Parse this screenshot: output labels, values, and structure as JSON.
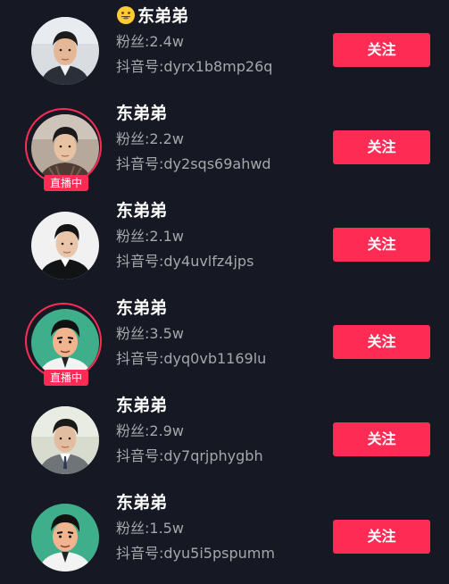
{
  "follow_label": "关注",
  "live_label": "直播中",
  "accent_color": "#fe2c55",
  "background_color": "#161823",
  "users": [
    {
      "name": "东弟弟",
      "name_emoji": "grinning-face-emoji",
      "fans": "粉丝:2.4w",
      "douyin_id": "抖音号:dyrx1b8mp26q",
      "is_live": false,
      "avatar": "man-dark-suit-avatar"
    },
    {
      "name": "东弟弟",
      "fans": "粉丝:2.2w",
      "douyin_id": "抖音号:dy2sqs69ahwd",
      "is_live": true,
      "avatar": "man-checked-shirt-avatar"
    },
    {
      "name": "东弟弟",
      "fans": "粉丝:2.1w",
      "douyin_id": "抖音号:dy4uvlfz4jps",
      "is_live": false,
      "avatar": "man-black-coat-avatar"
    },
    {
      "name": "东弟弟",
      "fans": "粉丝:3.5w",
      "douyin_id": "抖音号:dyq0vb1169lu",
      "is_live": true,
      "avatar": "cartoon-man-green-avatar"
    },
    {
      "name": "东弟弟",
      "fans": "粉丝:2.9w",
      "douyin_id": "抖音号:dy7qrjphygbh",
      "is_live": false,
      "avatar": "man-grey-suit-avatar"
    },
    {
      "name": "东弟弟",
      "fans": "粉丝:1.5w",
      "douyin_id": "抖音号:dyu5i5pspumm",
      "is_live": false,
      "avatar": "cartoon-man-green-avatar"
    }
  ]
}
